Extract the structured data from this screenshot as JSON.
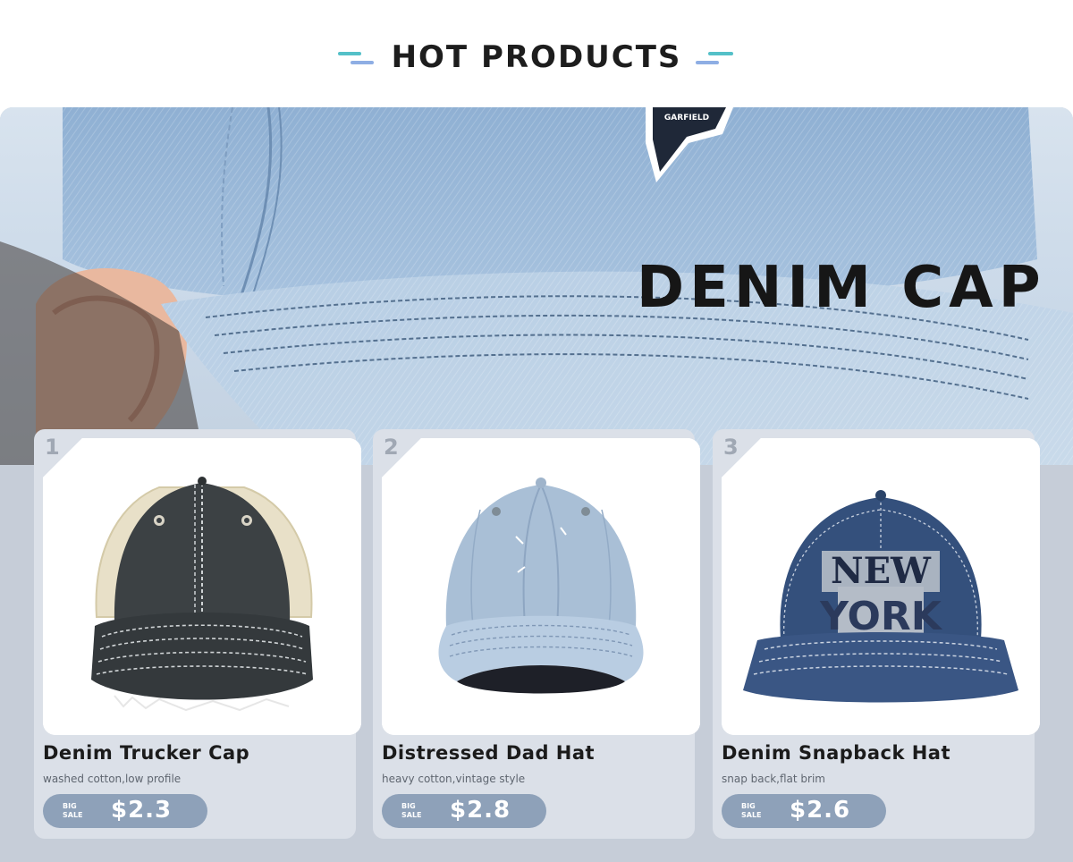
{
  "header": {
    "title": "HOT PRODUCTS"
  },
  "hero": {
    "title": "DENIM  CAP",
    "patch_text": "GARFIELD"
  },
  "products": [
    {
      "rank": "1",
      "name": "Denim Trucker Cap",
      "desc": "washed cotton,low profile",
      "badge_top": "BIG",
      "badge_bottom": "SALE",
      "price": "$2.3"
    },
    {
      "rank": "2",
      "name": "Distressed  Dad  Hat",
      "desc": "heavy cotton,vintage style",
      "badge_top": "BIG",
      "badge_bottom": "SALE",
      "price": "$2.8"
    },
    {
      "rank": "3",
      "name": "Denim Snapback Hat",
      "desc": "snap back,flat brim",
      "badge_top": "BIG",
      "badge_bottom": "SALE",
      "price": "$2.6"
    }
  ],
  "embroidery": {
    "line1": "NEW",
    "line2": "YORK"
  },
  "colors": {
    "accent_teal": "#54c0c8",
    "accent_blue": "#8eaee4",
    "price_pill": "#8ea1b9",
    "panel_bg": "#c6cdd8"
  }
}
